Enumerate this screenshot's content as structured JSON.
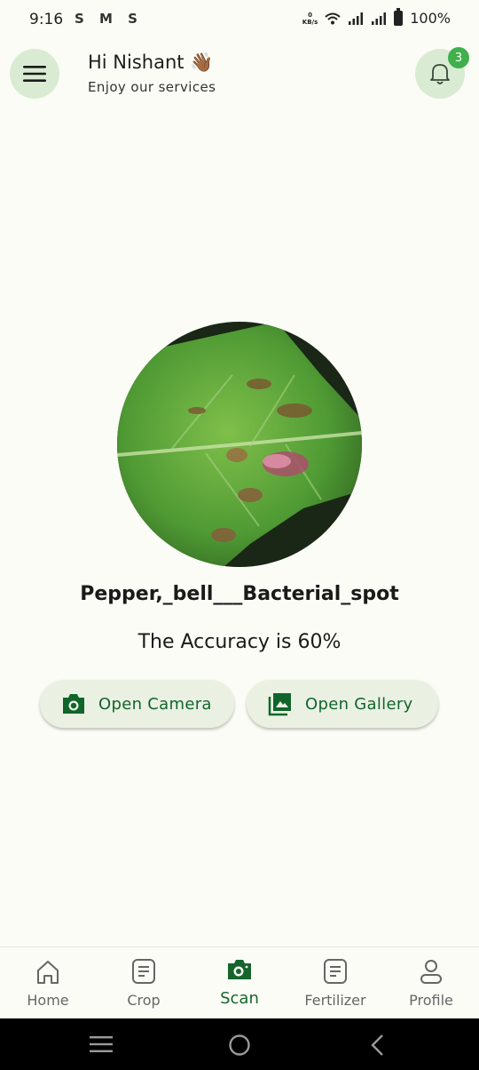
{
  "status_bar": {
    "time": "9:16",
    "app_icons": "S M S",
    "kbs_top": "0",
    "kbs_bottom": "KB/s",
    "battery": "100%"
  },
  "header": {
    "greeting": "Hi Nishant 👋🏾",
    "subtitle": "Enjoy our services",
    "notification_count": "3"
  },
  "result": {
    "disease_name": "Pepper,_bell___Bacterial_spot",
    "accuracy_text": "The Accuracy is 60%"
  },
  "actions": {
    "camera_label": "Open Camera",
    "gallery_label": "Open Gallery"
  },
  "nav": {
    "items": [
      {
        "label": "Home",
        "icon": "home-icon"
      },
      {
        "label": "Crop",
        "icon": "document-icon"
      },
      {
        "label": "Scan",
        "icon": "camera-icon",
        "active": true
      },
      {
        "label": "Fertilizer",
        "icon": "document-icon"
      },
      {
        "label": "Profile",
        "icon": "person-icon"
      }
    ]
  },
  "colors": {
    "accent": "#16652c",
    "badge": "#3fb04a",
    "button_bg": "#eaf1e3",
    "circle_bg": "#d9ebd3"
  }
}
